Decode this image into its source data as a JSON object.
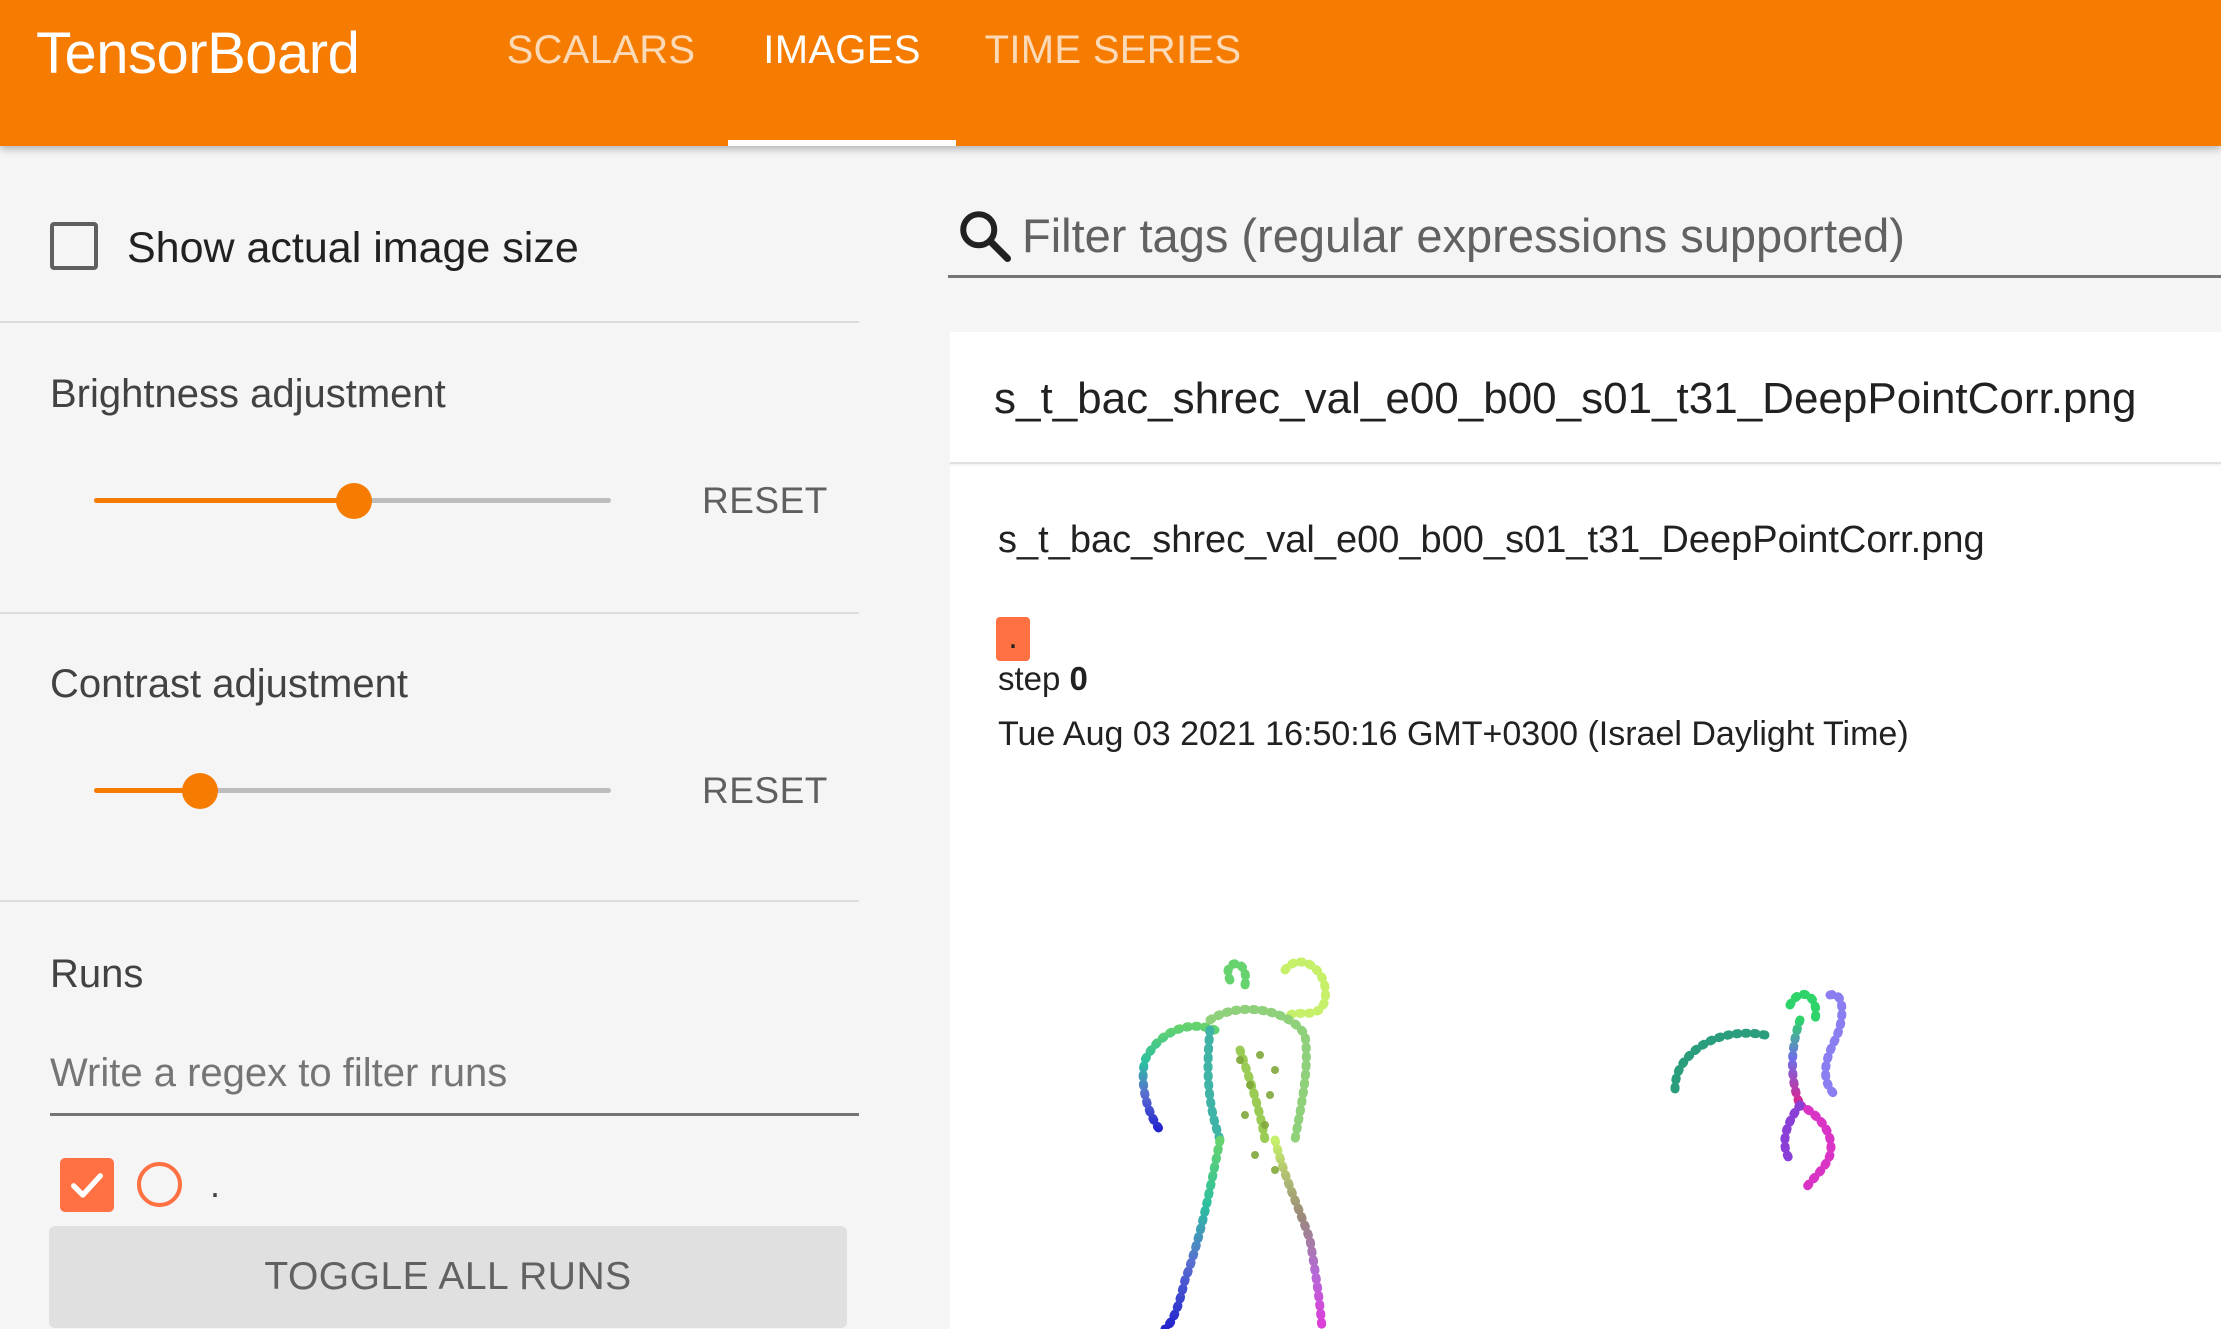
{
  "app": {
    "title": "TensorBoard",
    "brand_color": "#f57c00",
    "tabs": [
      {
        "label": "SCALARS",
        "active": false
      },
      {
        "label": "IMAGES",
        "active": true
      },
      {
        "label": "TIME SERIES",
        "active": false
      }
    ]
  },
  "sidebar": {
    "show_actual_size": {
      "label": "Show actual image size",
      "checked": false
    },
    "brightness": {
      "label": "Brightness adjustment",
      "value_fraction": 0.5,
      "reset_label": "RESET"
    },
    "contrast": {
      "label": "Contrast adjustment",
      "value_fraction": 0.2,
      "reset_label": "RESET"
    },
    "runs": {
      "title": "Runs",
      "filter_placeholder": "Write a regex to filter runs",
      "items": [
        {
          "name": ".",
          "checked": true,
          "color": "#ff7043"
        }
      ],
      "toggle_all_label": "TOGGLE ALL RUNS"
    }
  },
  "main": {
    "filter": {
      "placeholder": "Filter tags (regular expressions supported)",
      "icon": "search-icon"
    },
    "card": {
      "tag": "s_t_bac_shrec_val_e00_b00_s01_t31_DeepPointCorr.png",
      "image_name": "s_t_bac_shrec_val_e00_b00_s01_t31_DeepPointCorr.png",
      "run_label": ".",
      "step_prefix": "step",
      "step_value": "0",
      "timestamp": "Tue Aug 03 2021 16:50:16 GMT+0300 (Israel Daylight Time)"
    }
  }
}
